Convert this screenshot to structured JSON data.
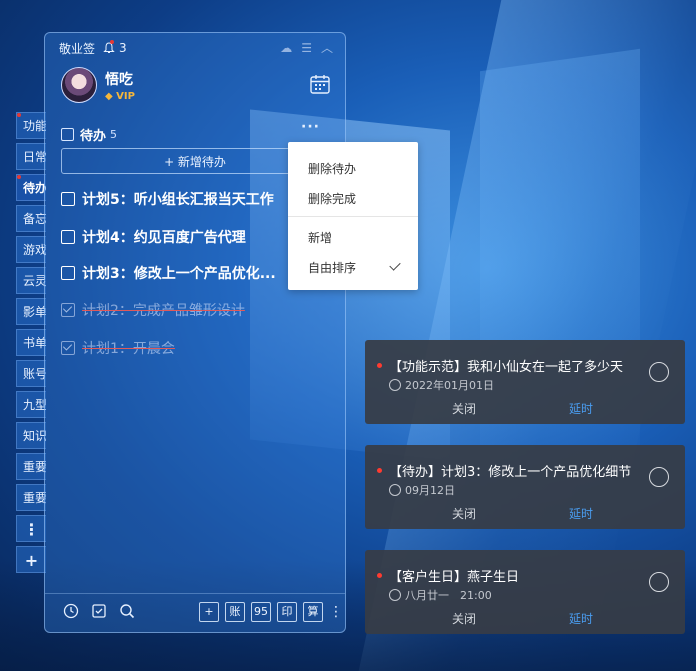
{
  "app": {
    "name": "敬业签",
    "bell_count": "3"
  },
  "user": {
    "name": "悟吃",
    "badge": "VIP"
  },
  "side_tabs": [
    {
      "label": "功能",
      "dot": true
    },
    {
      "label": "日常",
      "dot": false
    },
    {
      "label": "待办",
      "dot": true,
      "active": true
    },
    {
      "label": "备忘",
      "dot": false
    },
    {
      "label": "游戏",
      "dot": false
    },
    {
      "label": "云灵",
      "dot": false
    },
    {
      "label": "影单",
      "dot": false
    },
    {
      "label": "书单",
      "dot": false
    },
    {
      "label": "账号",
      "dot": false
    },
    {
      "label": "九型",
      "dot": false
    },
    {
      "label": "知识",
      "dot": false
    },
    {
      "label": "重要",
      "dot": false
    },
    {
      "label": "重要",
      "dot": false
    }
  ],
  "side_more": "⋮",
  "side_add": "+",
  "section": {
    "title": "待办",
    "count": "5",
    "more": "···"
  },
  "add_button": "+ 新增待办",
  "tasks": [
    {
      "text": "计划5：听小组长汇报当天工作",
      "done": false
    },
    {
      "text": "计划4：约见百度广告代理",
      "done": false
    },
    {
      "text": "计划3：修改上一个产品优化...",
      "done": false
    },
    {
      "text": "计划2：完成产品雏形设计",
      "done": true
    },
    {
      "text": "计划1：开晨会",
      "done": true
    }
  ],
  "bottom_buttons": [
    "+",
    "账",
    "95",
    "印",
    "算"
  ],
  "context_menu": {
    "items": [
      "删除待办",
      "删除完成",
      "新增",
      "自由排序"
    ],
    "checked": "自由排序"
  },
  "notifications": [
    {
      "title": "【功能示范】我和小仙女在一起了多少天",
      "sub": "2022年01月01日",
      "icon": "clock-icon",
      "close": "关闭",
      "delay": "延时"
    },
    {
      "title": "【待办】计划3：修改上一个产品优化细节",
      "sub": "09月12日",
      "icon": "clock-icon",
      "close": "关闭",
      "delay": "延时"
    },
    {
      "title": "【客户生日】燕子生日",
      "sub": "八月廿一　21:00",
      "icon": "repeat-icon",
      "close": "关闭",
      "delay": "延时"
    }
  ],
  "colors": {
    "accent": "#4a9df0",
    "badge": "#f5b73b",
    "alert": "#ff3b30"
  }
}
